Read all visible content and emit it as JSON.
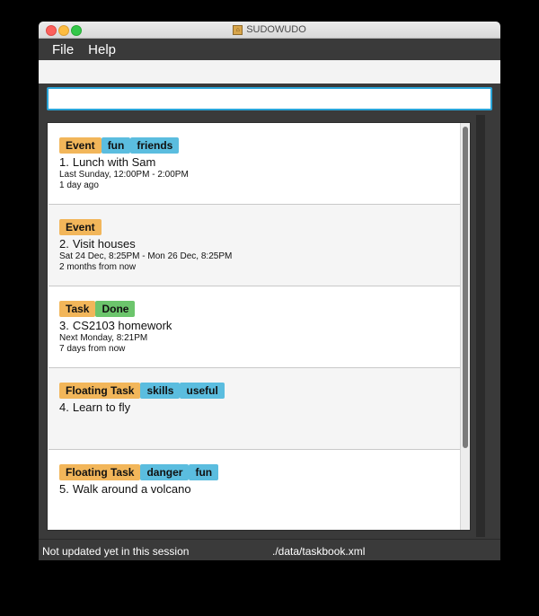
{
  "window": {
    "title": "SUDOWUDO",
    "icon": "app-icon"
  },
  "menu": {
    "items": [
      "File",
      "Help"
    ]
  },
  "command": {
    "value": "",
    "placeholder": ""
  },
  "tasks": [
    {
      "index": "1.",
      "name": "Lunch with Sam",
      "tags": [
        {
          "text": "Event",
          "kind": "type"
        },
        {
          "text": "fun",
          "kind": "label"
        },
        {
          "text": "friends",
          "kind": "label"
        }
      ],
      "line1": "Last Sunday, 12:00PM - 2:00PM",
      "line2": "1 day ago"
    },
    {
      "index": "2.",
      "name": "Visit houses",
      "tags": [
        {
          "text": "Event",
          "kind": "type"
        }
      ],
      "line1": "Sat 24 Dec, 8:25PM - Mon 26 Dec, 8:25PM",
      "line2": "2 months from now"
    },
    {
      "index": "3.",
      "name": "CS2103 homework",
      "tags": [
        {
          "text": "Task",
          "kind": "type"
        },
        {
          "text": "Done",
          "kind": "done"
        }
      ],
      "line1": "Next Monday, 8:21PM",
      "line2": "7 days from now"
    },
    {
      "index": "4.",
      "name": "Learn to fly",
      "tags": [
        {
          "text": "Floating Task",
          "kind": "type"
        },
        {
          "text": "skills",
          "kind": "label"
        },
        {
          "text": "useful",
          "kind": "label"
        }
      ],
      "line1": "",
      "line2": ""
    },
    {
      "index": "5.",
      "name": "Walk around a volcano",
      "tags": [
        {
          "text": "Floating Task",
          "kind": "type"
        },
        {
          "text": "danger",
          "kind": "label"
        },
        {
          "text": "fun",
          "kind": "label"
        }
      ],
      "line1": "",
      "line2": ""
    }
  ],
  "status": {
    "sync": "Not updated yet in this session",
    "file": "./data/taskbook.xml"
  },
  "colors": {
    "type_tag": "#f2b65a",
    "label_tag": "#5bbddf",
    "done_tag": "#6cc56c",
    "input_border": "#2aa4d8"
  }
}
